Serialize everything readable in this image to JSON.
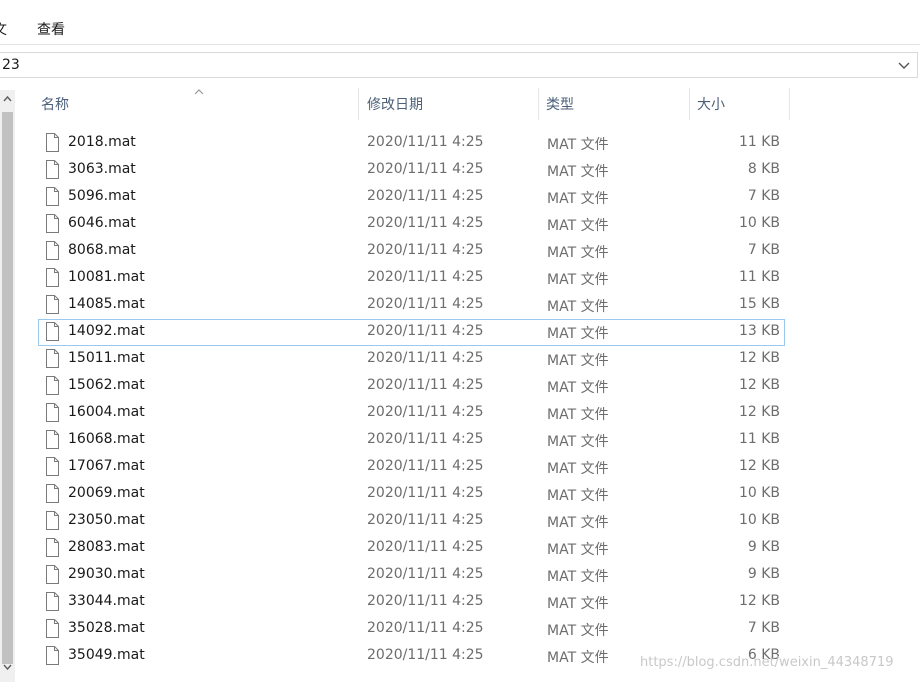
{
  "ribbon": {
    "tab_partial": "文",
    "tab_view": "查看"
  },
  "address": {
    "path": "23"
  },
  "columns": {
    "name": "名称",
    "modified": "修改日期",
    "type": "类型",
    "size": "大小"
  },
  "files": [
    {
      "name": "2018.mat",
      "date": "2020/11/11 4:25",
      "type": "MAT 文件",
      "size": "11 KB"
    },
    {
      "name": "3063.mat",
      "date": "2020/11/11 4:25",
      "type": "MAT 文件",
      "size": "8 KB"
    },
    {
      "name": "5096.mat",
      "date": "2020/11/11 4:25",
      "type": "MAT 文件",
      "size": "7 KB"
    },
    {
      "name": "6046.mat",
      "date": "2020/11/11 4:25",
      "type": "MAT 文件",
      "size": "10 KB"
    },
    {
      "name": "8068.mat",
      "date": "2020/11/11 4:25",
      "type": "MAT 文件",
      "size": "7 KB"
    },
    {
      "name": "10081.mat",
      "date": "2020/11/11 4:25",
      "type": "MAT 文件",
      "size": "11 KB"
    },
    {
      "name": "14085.mat",
      "date": "2020/11/11 4:25",
      "type": "MAT 文件",
      "size": "15 KB"
    },
    {
      "name": "14092.mat",
      "date": "2020/11/11 4:25",
      "type": "MAT 文件",
      "size": "13 KB"
    },
    {
      "name": "15011.mat",
      "date": "2020/11/11 4:25",
      "type": "MAT 文件",
      "size": "12 KB"
    },
    {
      "name": "15062.mat",
      "date": "2020/11/11 4:25",
      "type": "MAT 文件",
      "size": "12 KB"
    },
    {
      "name": "16004.mat",
      "date": "2020/11/11 4:25",
      "type": "MAT 文件",
      "size": "12 KB"
    },
    {
      "name": "16068.mat",
      "date": "2020/11/11 4:25",
      "type": "MAT 文件",
      "size": "11 KB"
    },
    {
      "name": "17067.mat",
      "date": "2020/11/11 4:25",
      "type": "MAT 文件",
      "size": "12 KB"
    },
    {
      "name": "20069.mat",
      "date": "2020/11/11 4:25",
      "type": "MAT 文件",
      "size": "10 KB"
    },
    {
      "name": "23050.mat",
      "date": "2020/11/11 4:25",
      "type": "MAT 文件",
      "size": "10 KB"
    },
    {
      "name": "28083.mat",
      "date": "2020/11/11 4:25",
      "type": "MAT 文件",
      "size": "9 KB"
    },
    {
      "name": "29030.mat",
      "date": "2020/11/11 4:25",
      "type": "MAT 文件",
      "size": "9 KB"
    },
    {
      "name": "33044.mat",
      "date": "2020/11/11 4:25",
      "type": "MAT 文件",
      "size": "12 KB"
    },
    {
      "name": "35028.mat",
      "date": "2020/11/11 4:25",
      "type": "MAT 文件",
      "size": "7 KB"
    },
    {
      "name": "35049.mat",
      "date": "2020/11/11 4:25",
      "type": "MAT 文件",
      "size": "6 KB"
    }
  ],
  "selected_file": "14092.mat",
  "watermark": "https://blog.csdn.net/weixin_44348719",
  "colors": {
    "header_text": "#4c607a",
    "meta_text": "#6d6d6d",
    "selection_border": "#99c9ef"
  },
  "icons": {
    "file": "document-icon",
    "sort": "sort-ascending-caret-icon",
    "dropdown": "chevron-down-icon"
  }
}
